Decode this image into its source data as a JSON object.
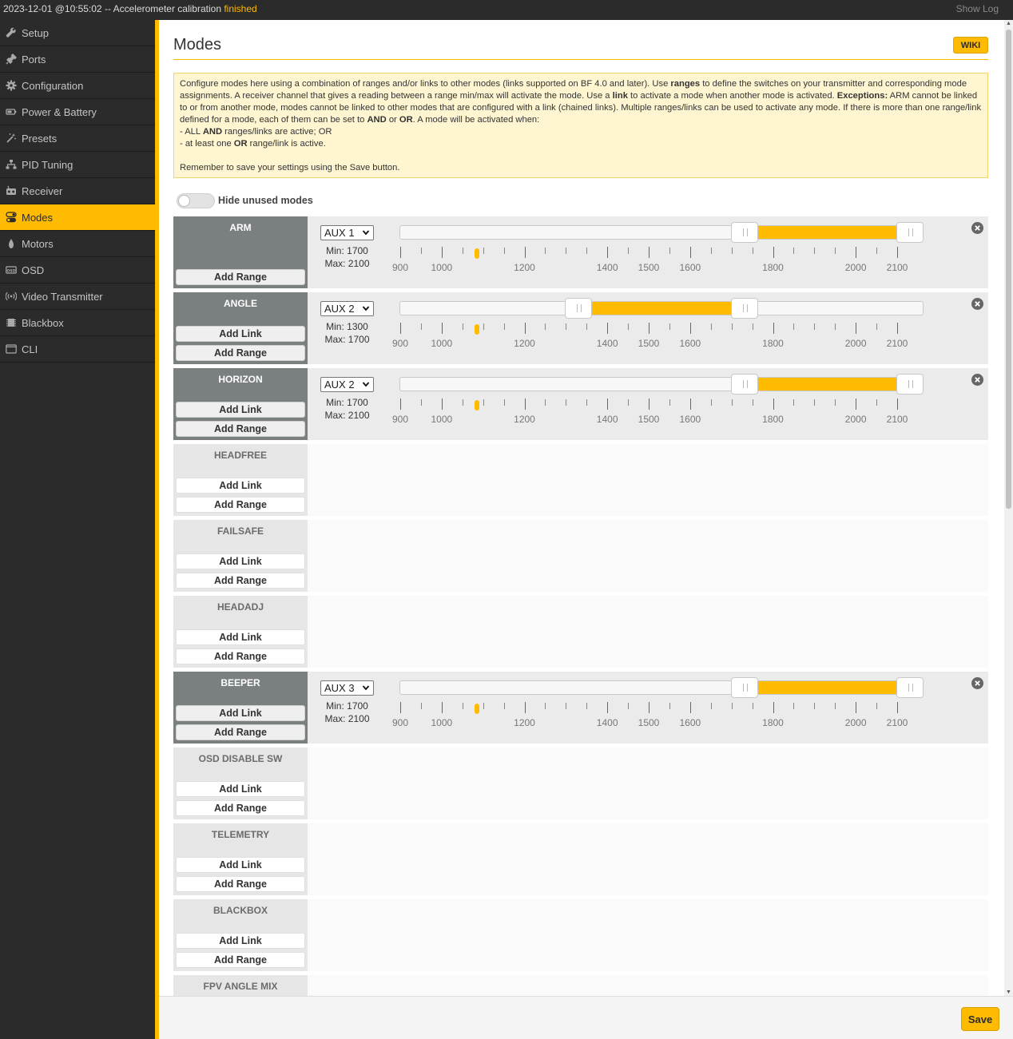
{
  "log": {
    "prefix": "2023-12-01 @10:55:02 -- Accelerometer calibration ",
    "status": "finished",
    "show_log": "Show Log"
  },
  "sidebar": {
    "items": [
      {
        "label": "Setup",
        "icon": "wrench-icon"
      },
      {
        "label": "Ports",
        "icon": "plug-icon"
      },
      {
        "label": "Configuration",
        "icon": "gear-icon"
      },
      {
        "label": "Power & Battery",
        "icon": "battery-icon"
      },
      {
        "label": "Presets",
        "icon": "magic-wand-icon"
      },
      {
        "label": "PID Tuning",
        "icon": "sitemap-icon"
      },
      {
        "label": "Receiver",
        "icon": "remote-control-icon"
      },
      {
        "label": "Modes",
        "icon": "toggles-icon"
      },
      {
        "label": "Motors",
        "icon": "motor-icon"
      },
      {
        "label": "OSD",
        "icon": "osd-icon"
      },
      {
        "label": "Video Transmitter",
        "icon": "broadcast-icon"
      },
      {
        "label": "Blackbox",
        "icon": "blackbox-icon"
      },
      {
        "label": "CLI",
        "icon": "terminal-icon"
      }
    ],
    "active_index": 7
  },
  "header": {
    "title": "Modes",
    "wiki_label": "WIKI"
  },
  "note": {
    "p1_a": "Configure modes here using a combination of ranges and/or links to other modes (links supported on BF 4.0 and later). Use ",
    "p1_ranges": "ranges",
    "p1_b": " to define the switches on your transmitter and corresponding mode assignments. A receiver channel that gives a reading between a range min/max will activate the mode. Use a ",
    "p1_link": "link",
    "p1_c": " to activate a mode when another mode is activated. ",
    "p1_exceptions": "Exceptions:",
    "p1_d": " ARM cannot be linked to or from another mode, modes cannot be linked to other modes that are configured with a link (chained links). Multiple ranges/links can be used to activate any mode. If there is more than one range/link defined for a mode, each of them can be set to ",
    "p1_and": "AND",
    "p1_e": " or ",
    "p1_or": "OR",
    "p1_f": ". A mode will be activated when:",
    "l1_a": "- ALL ",
    "l1_and": "AND",
    "l1_b": " ranges/links are active; OR",
    "l2_a": "- at least one ",
    "l2_or": "OR",
    "l2_b": " range/link is active.",
    "p2": "Remember to save your settings using the Save button."
  },
  "hide_unused": {
    "label": "Hide unused modes",
    "enabled": false
  },
  "scale": {
    "ticks": [
      900,
      950,
      1000,
      1050,
      1100,
      1150,
      1200,
      1250,
      1300,
      1350,
      1400,
      1450,
      1500,
      1550,
      1600,
      1650,
      1700,
      1750,
      1800,
      1850,
      1900,
      1950,
      2000,
      2050,
      2100
    ],
    "labels": [
      "900",
      "1000",
      "1200",
      "1400",
      "1500",
      "1600",
      "1800",
      "2000",
      "2100"
    ]
  },
  "add_link_label": "Add Link",
  "add_range_label": "Add Range",
  "modes": [
    {
      "name": "ARM",
      "has_link": false,
      "range": {
        "aux": "AUX 1",
        "min": 1700,
        "max": 2100,
        "min_label": "Min: 1700",
        "max_label": "Max: 2100",
        "current": 1085
      }
    },
    {
      "name": "ANGLE",
      "has_link": true,
      "range": {
        "aux": "AUX 2",
        "min": 1300,
        "max": 1700,
        "min_label": "Min: 1300",
        "max_label": "Max: 1700",
        "current": 1085
      }
    },
    {
      "name": "HORIZON",
      "has_link": true,
      "range": {
        "aux": "AUX 2",
        "min": 1700,
        "max": 2100,
        "min_label": "Min: 1700",
        "max_label": "Max: 2100",
        "current": 1085
      }
    },
    {
      "name": "HEADFREE",
      "has_link": true,
      "range": null
    },
    {
      "name": "FAILSAFE",
      "has_link": true,
      "range": null
    },
    {
      "name": "HEADADJ",
      "has_link": true,
      "range": null
    },
    {
      "name": "BEEPER",
      "has_link": true,
      "range": {
        "aux": "AUX 3",
        "min": 1700,
        "max": 2100,
        "min_label": "Min: 1700",
        "max_label": "Max: 2100",
        "current": 1085
      }
    },
    {
      "name": "OSD DISABLE SW",
      "has_link": true,
      "range": null
    },
    {
      "name": "TELEMETRY",
      "has_link": true,
      "range": null
    },
    {
      "name": "BLACKBOX",
      "has_link": true,
      "range": null
    },
    {
      "name": "FPV ANGLE MIX",
      "has_link": true,
      "range": null
    }
  ],
  "footer": {
    "save_label": "Save"
  }
}
